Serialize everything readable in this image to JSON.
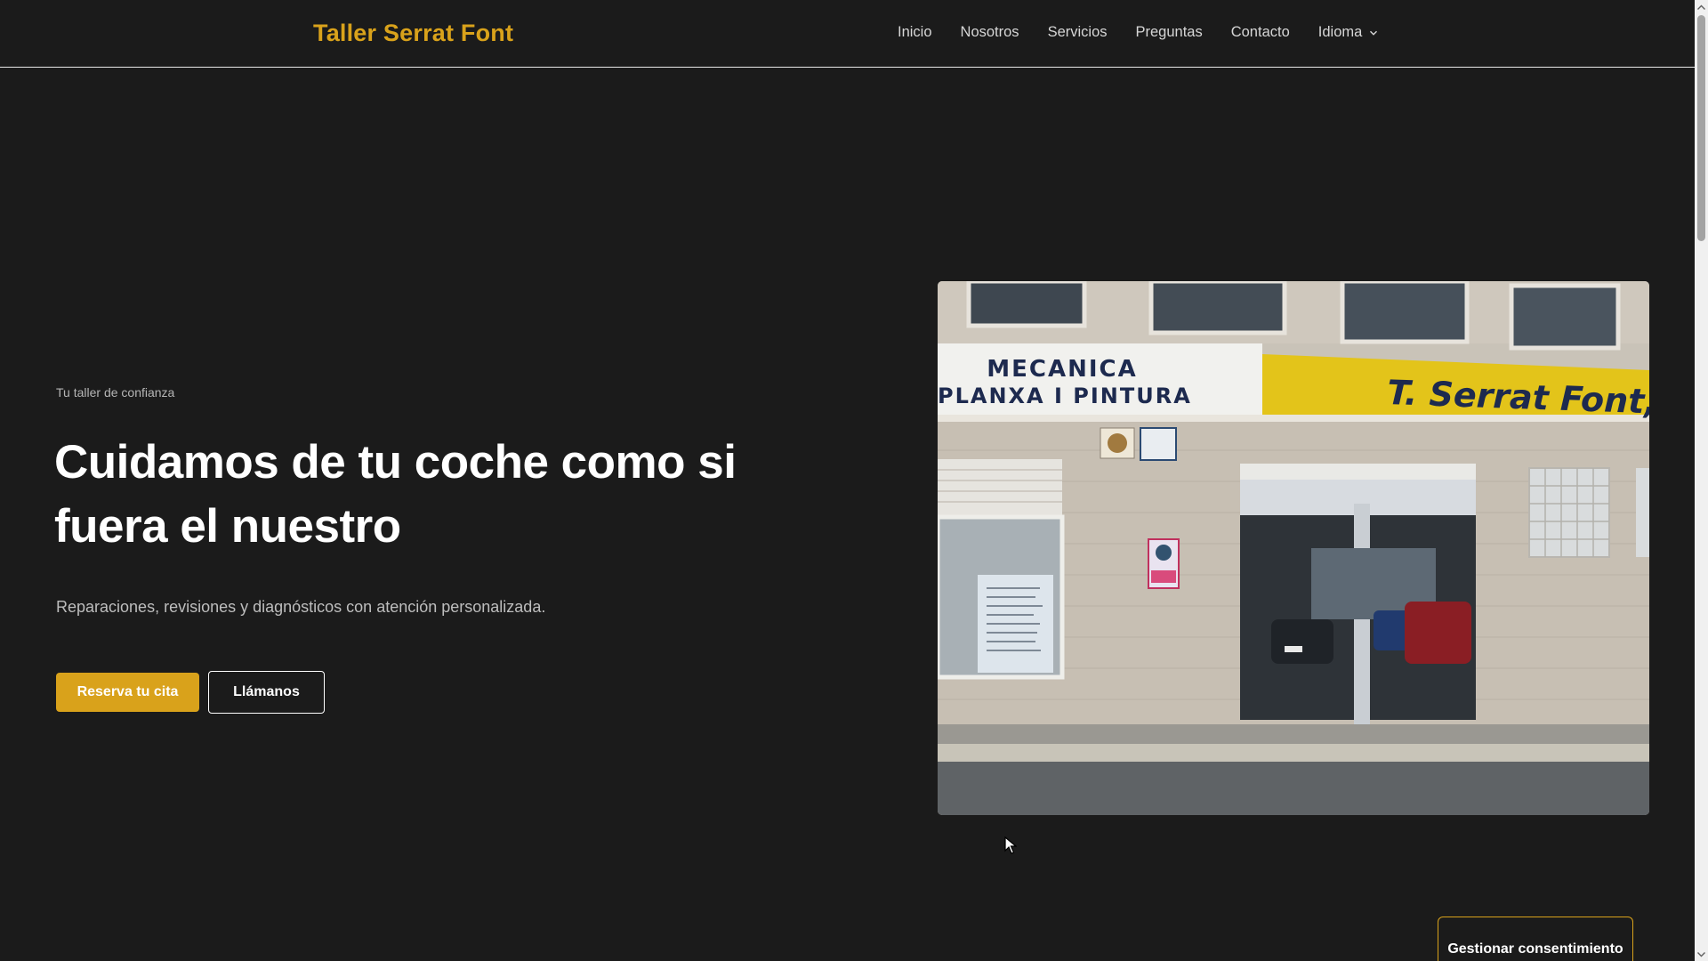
{
  "header": {
    "brand": "Taller Serrat Font",
    "nav": [
      {
        "label": "Inicio"
      },
      {
        "label": "Nosotros"
      },
      {
        "label": "Servicios"
      },
      {
        "label": "Preguntas"
      },
      {
        "label": "Contacto"
      }
    ],
    "language_label": "Idioma"
  },
  "hero": {
    "eyebrow": "Tu taller de confianza",
    "title": "Cuidamos de tu coche como si fuera el nuestro",
    "subtitle": "Reparaciones, revisiones y diagnósticos con atención personalizada.",
    "primary_button": "Reserva tu cita",
    "secondary_button": "Llámanos",
    "photo": {
      "sign_left_line1": "MECANICA",
      "sign_left_line2": "PLANXA I PINTURA",
      "sign_right": "T. Serrat Font,S"
    }
  },
  "consent": {
    "label": "Gestionar consentimiento"
  },
  "colors": {
    "accent": "#d9a21b",
    "background": "#1b1b1b",
    "text": "#ffffff",
    "muted": "#bdbdbd"
  }
}
